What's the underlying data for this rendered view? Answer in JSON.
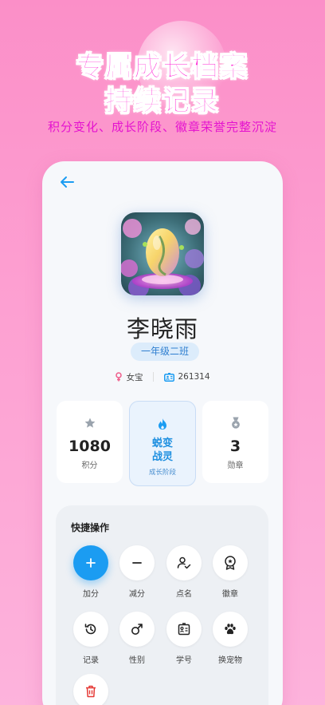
{
  "promo": {
    "title_line1": "专属成长档案",
    "title_line2": "持续记录",
    "subtitle": "积分变化、成长阶段、徽章荣誉完整沉淀"
  },
  "profile": {
    "name": "李晓雨",
    "class": "一年级二班",
    "gender": "女宝",
    "student_id": "261314"
  },
  "stats": {
    "points_value": "1080",
    "points_label": "积分",
    "stage_value_line1": "蜕变",
    "stage_value_line2": "战灵",
    "stage_label": "成长阶段",
    "badges_value": "3",
    "badges_label": "勋章"
  },
  "quick": {
    "title": "快捷操作",
    "actions": [
      {
        "label": "加分",
        "icon": "plus-icon"
      },
      {
        "label": "减分",
        "icon": "minus-icon"
      },
      {
        "label": "点名",
        "icon": "roll-call-icon"
      },
      {
        "label": "徽章",
        "icon": "badge-icon"
      },
      {
        "label": "记录",
        "icon": "history-icon"
      },
      {
        "label": "性别",
        "icon": "male-icon"
      },
      {
        "label": "学号",
        "icon": "id-card-icon"
      },
      {
        "label": "换宠物",
        "icon": "paw-icon"
      },
      {
        "label": "",
        "icon": "trash-icon"
      }
    ]
  },
  "colors": {
    "accent": "#1b9cf2",
    "promo_title": "#ff18d2",
    "background": "#fb8fc8"
  }
}
